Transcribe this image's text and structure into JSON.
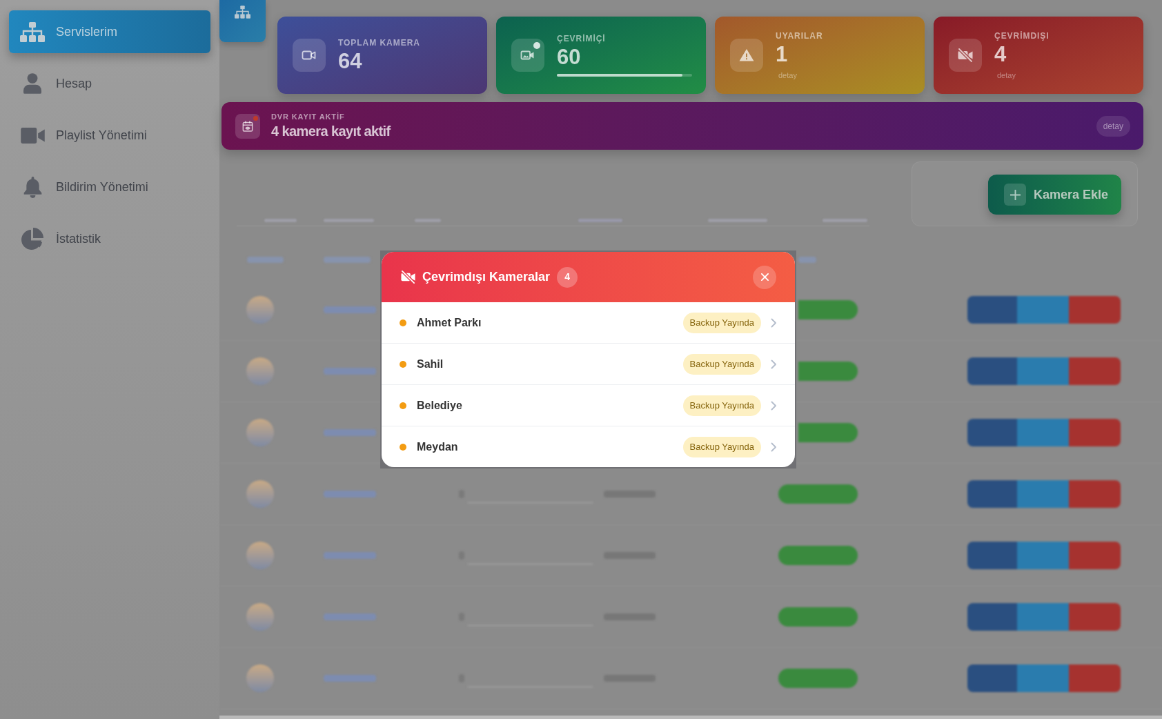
{
  "sidebar": {
    "items": [
      {
        "label": "Servislerim",
        "selected": true
      },
      {
        "label": "Hesap",
        "selected": false
      },
      {
        "label": "Playlist Yönetimi",
        "selected": false
      },
      {
        "label": "Bildirim Yönetimi",
        "selected": false
      },
      {
        "label": "İstatistik",
        "selected": false
      }
    ]
  },
  "stats": [
    {
      "label": "TOPLAM KAMERA",
      "value": "64"
    },
    {
      "label": "ÇEVRİMİÇİ",
      "value": "60",
      "level": 0.93
    },
    {
      "label": "UYARILAR",
      "value": "1",
      "detail": "detay"
    },
    {
      "label": "ÇEVRİMDIŞI",
      "value": "4",
      "detail": "detay"
    }
  ],
  "dvr_banner": {
    "label": "DVR KAYIT AKTİF",
    "text": "4 kamera kayıt aktif",
    "detail": "detay"
  },
  "add_button": {
    "label": "Kamera Ekle"
  },
  "modal": {
    "title": "Çevrimdışı Kameralar",
    "count": "4",
    "cameras": [
      {
        "name": "Ahmet Parkı",
        "status": "Backup Yayında"
      },
      {
        "name": "Sahil",
        "status": "Backup Yayında"
      },
      {
        "name": "Belediye",
        "status": "Backup Yayında"
      },
      {
        "name": "Meydan",
        "status": "Backup Yayında"
      }
    ]
  }
}
